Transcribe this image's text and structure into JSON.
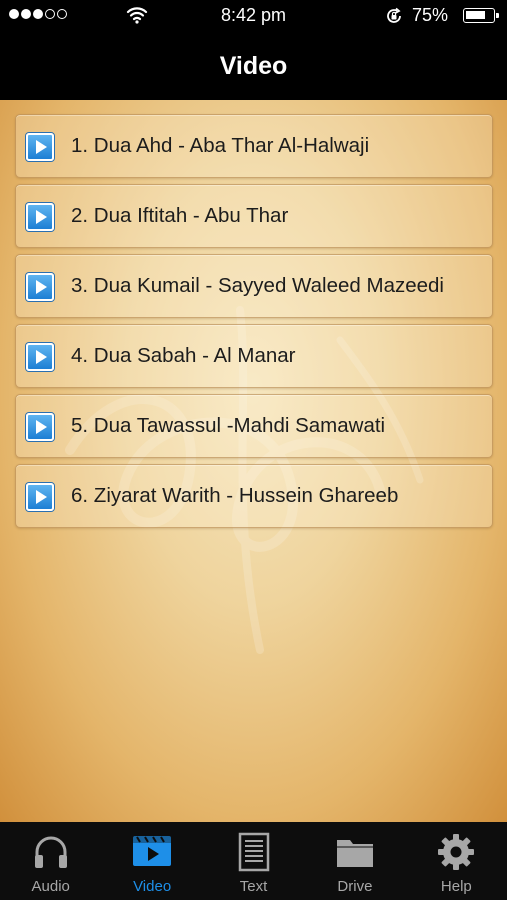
{
  "status_bar": {
    "time": "8:42 pm",
    "battery_percent": "75%",
    "battery_level": 0.75,
    "signal_bars_filled": 3,
    "signal_bars_total": 5
  },
  "nav": {
    "title": "Video"
  },
  "videos": [
    {
      "label": "1. Dua Ahd - Aba Thar Al-Halwaji"
    },
    {
      "label": "2. Dua Iftitah - Abu Thar"
    },
    {
      "label": "3. Dua Kumail - Sayyed Waleed Mazeedi"
    },
    {
      "label": "4. Dua Sabah - Al Manar"
    },
    {
      "label": "5. Dua Tawassul -Mahdi Samawati"
    },
    {
      "label": "6. Ziyarat Warith - Hussein Ghareeb"
    }
  ],
  "tabs": [
    {
      "label": "Audio",
      "icon": "headphones-icon",
      "active": false
    },
    {
      "label": "Video",
      "icon": "video-clapper-icon",
      "active": true
    },
    {
      "label": "Text",
      "icon": "document-icon",
      "active": false
    },
    {
      "label": "Drive",
      "icon": "folder-icon",
      "active": false
    },
    {
      "label": "Help",
      "icon": "gear-icon",
      "active": false
    }
  ],
  "colors": {
    "accent": "#1e8fe8",
    "tab_inactive": "#a7a7a7",
    "bar_background": "#000000",
    "parchment": "#efd49d"
  }
}
